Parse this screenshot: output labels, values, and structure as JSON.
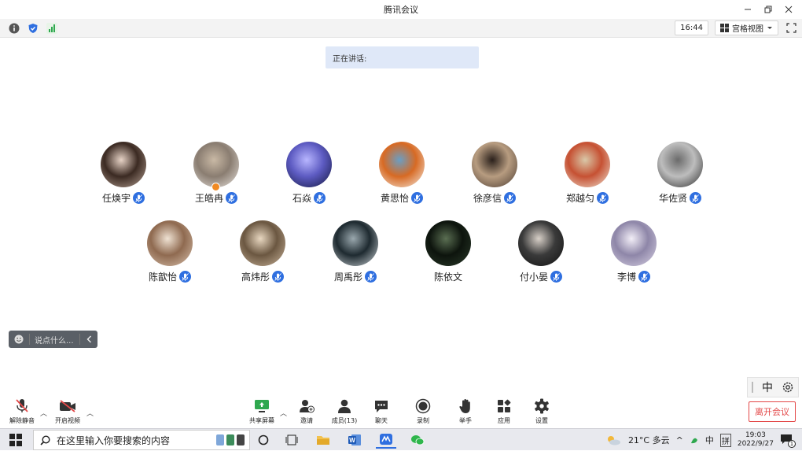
{
  "window": {
    "title": "腾讯会议"
  },
  "infobar": {
    "time": "16:44",
    "view_label": "宫格视图"
  },
  "speaking": {
    "label": "正在讲话:"
  },
  "participants": [
    {
      "name": "任焕宇",
      "muted_icon": true,
      "avatar_colors": [
        "#b8a396",
        "#3b2a22",
        "#e7d3c6"
      ]
    },
    {
      "name": "王皓冉",
      "muted_icon": true,
      "host": true,
      "avatar_colors": [
        "#e9e4df",
        "#8a7d71",
        "#c9b9a5"
      ]
    },
    {
      "name": "石焱",
      "muted_icon": true,
      "avatar_colors": [
        "#12163b",
        "#5d5bc2",
        "#b8b6ff"
      ]
    },
    {
      "name": "黄思怡",
      "muted_icon": true,
      "avatar_colors": [
        "#f5efe6",
        "#d76a24",
        "#6a9ec4"
      ]
    },
    {
      "name": "徐彦信",
      "muted_icon": true,
      "avatar_colors": [
        "#4a3a30",
        "#b79c80",
        "#2a201b"
      ]
    },
    {
      "name": "郑越匀",
      "muted_icon": true,
      "avatar_colors": [
        "#efe6d6",
        "#c65133",
        "#d9c8a8"
      ]
    },
    {
      "name": "华佐贤",
      "muted_icon": true,
      "avatar_colors": [
        "#2a2a2a",
        "#bdbdbd",
        "#6b6b6b"
      ]
    },
    {
      "name": "陈歆怡",
      "muted_icon": true,
      "avatar_colors": [
        "#d9c2ae",
        "#8f6a50",
        "#efe2d3"
      ]
    },
    {
      "name": "高炜彤",
      "muted_icon": true,
      "avatar_colors": [
        "#c9b49b",
        "#6b5741",
        "#e8d7c0"
      ]
    },
    {
      "name": "周禹彤",
      "muted_icon": true,
      "avatar_colors": [
        "#cfd6da",
        "#1e2a30",
        "#9aa8ae"
      ]
    },
    {
      "name": "陈依文",
      "muted_icon": false,
      "avatar_colors": [
        "#2b3b2a",
        "#0d140d",
        "#5a6e52"
      ]
    },
    {
      "name": "付小晏",
      "muted_icon": true,
      "avatar_colors": [
        "#111111",
        "#3a3a3a",
        "#d8d0c8"
      ]
    },
    {
      "name": "李博",
      "muted_icon": true,
      "avatar_colors": [
        "#d8d2e4",
        "#8e86a8",
        "#f2eef7"
      ]
    }
  ],
  "chat": {
    "placeholder": "说点什么..."
  },
  "toolbar": {
    "unmute": "解除静音",
    "start_video": "开启视频",
    "share_screen": "共享屏幕",
    "invite": "邀请",
    "members": "成员(13)",
    "chat": "聊天",
    "record": "录制",
    "raise_hand": "举手",
    "apps": "应用",
    "settings": "设置"
  },
  "ime": {
    "mode": "中"
  },
  "leave": {
    "label": "离开会议"
  },
  "taskbar": {
    "search_placeholder": "在这里输入你要搜索的内容",
    "weather": "21°C 多云",
    "input_mode": "中",
    "input_layout": "拼",
    "time": "19:03",
    "date": "2022/9/27",
    "notifications": "1"
  },
  "colors": {
    "accent": "#2f6fe0",
    "leave": "#e34848",
    "banner": "#dfe8f8"
  }
}
